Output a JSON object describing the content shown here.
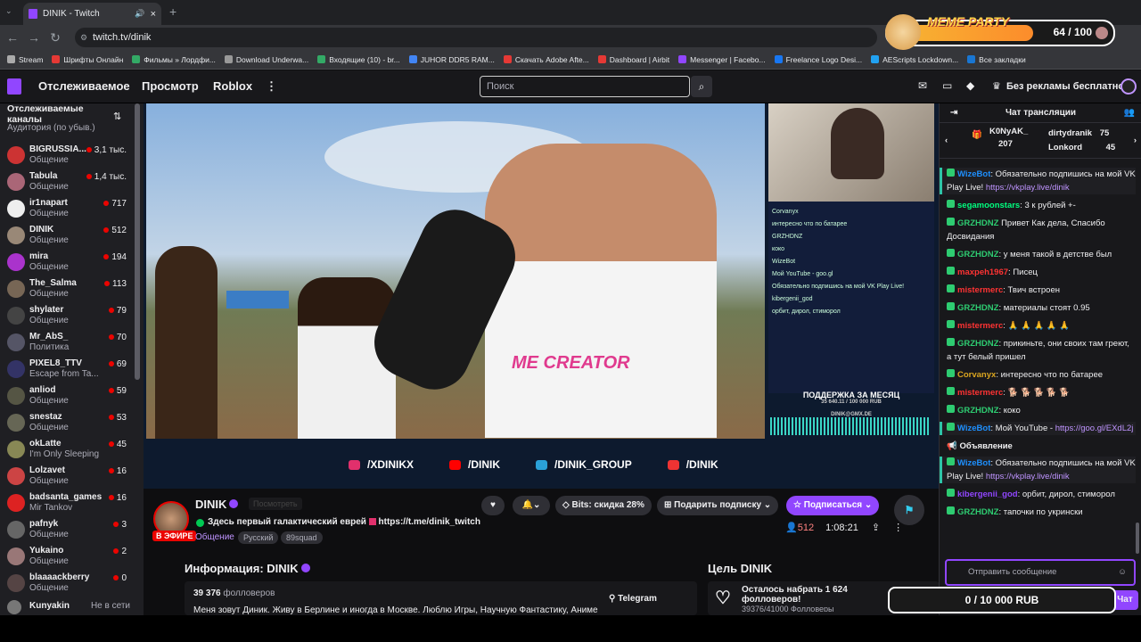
{
  "browser": {
    "tab_title": "DINIK - Twitch",
    "url": "twitch.tv/dinik",
    "bookmarks": [
      "Stream",
      "Шрифты Онлайн",
      "Фильмы » Лордфи...",
      "Download Underwa...",
      "Входящие (10) - br...",
      "JUHOR DDR5 RAM...",
      "Скачать Adobe Afte...",
      "Dashboard | Airbit",
      "Messenger | Facebo...",
      "Freelance Logo Desi...",
      "AEScripts Lockdown...",
      "Все закладки"
    ],
    "bookmark_colors": [
      "#aaaaaa",
      "#e53935",
      "#3a6",
      "#999999",
      "#3a6",
      "#4285f4",
      "#e53935",
      "#e53935",
      "#9146ff",
      "#1877f2",
      "#21a1f1",
      "#1976d2"
    ]
  },
  "meme_party": {
    "title": "MEME PARTY",
    "count": "64 / 100",
    "progress": 0.64
  },
  "twitch_nav": {
    "following": "Отслеживаемое",
    "browse": "Просмотр",
    "roblox": "Roblox",
    "search_placeholder": "Поиск",
    "no_ads": "Без рекламы бесплатно"
  },
  "sidebar": {
    "header": "Отслеживаемые каналы",
    "sort": "Аудитория (по убыв.)",
    "channels": [
      {
        "name": "BIGRUSSIA...",
        "category": "Общение",
        "viewers": "3,1 тыс.",
        "color": "#c33"
      },
      {
        "name": "Tabula",
        "category": "Общение",
        "viewers": "1,4 тыс.",
        "color": "#a67"
      },
      {
        "name": "ir1napart",
        "category": "Общение",
        "viewers": "717",
        "color": "#eee"
      },
      {
        "name": "DINIK",
        "category": "Общение",
        "viewers": "512",
        "color": "#987"
      },
      {
        "name": "mira",
        "category": "Общение",
        "viewers": "194",
        "color": "#a3c"
      },
      {
        "name": "The_Salma",
        "category": "Общение",
        "viewers": "113",
        "color": "#765"
      },
      {
        "name": "shylater",
        "category": "Общение",
        "viewers": "79",
        "color": "#444"
      },
      {
        "name": "Mr_AbS_",
        "category": "Политика",
        "viewers": "70",
        "color": "#556"
      },
      {
        "name": "PIXEL8_TTV",
        "category": "Escape from Ta...",
        "viewers": "69",
        "color": "#336"
      },
      {
        "name": "anliod",
        "category": "Общение",
        "viewers": "59",
        "color": "#554"
      },
      {
        "name": "snestaz",
        "category": "Общение",
        "viewers": "53",
        "color": "#665"
      },
      {
        "name": "okLatte",
        "category": "I'm Only Sleeping",
        "viewers": "45",
        "color": "#885"
      },
      {
        "name": "Lolzavet",
        "category": "Общение",
        "viewers": "16",
        "color": "#c44"
      },
      {
        "name": "badsanta_games",
        "category": "Mir Tankov",
        "viewers": "16",
        "color": "#d22"
      },
      {
        "name": "pafnyk",
        "category": "Общение",
        "viewers": "3",
        "color": "#666"
      },
      {
        "name": "Yukaino",
        "category": "Общение",
        "viewers": "2",
        "color": "#977"
      },
      {
        "name": "blaaaackberry",
        "category": "Общение",
        "viewers": "0",
        "color": "#544"
      }
    ],
    "offline": {
      "name": "Kunyakin",
      "status": "Не в сети"
    }
  },
  "video": {
    "shirt_text": "ME CREATOR",
    "overlay_chat": [
      "Corvanyx",
      "интересно что по батарее",
      "GRZHDNZ",
      "коко",
      "WizeBot",
      "Мой YouTube - goo.gl",
      "Обязательно подпишись на мой VK Play Live!",
      "kibergenii_god",
      "орбит, дирол, стиморол"
    ],
    "support_title": "ПОДДЕРЖКА ЗА МЕСЯЦ",
    "support_value": "35 640.11 / 100 000 RUB",
    "support_email": "DINIK@GMX.DE",
    "socials": [
      {
        "text": "/XDINIKX",
        "color": "#e1306c"
      },
      {
        "text": "/DINIK",
        "color": "#ff0000"
      },
      {
        "text": "/DINIK_GROUP",
        "color": "#2aa1d8"
      },
      {
        "text": "/DINIK",
        "color": "#e33"
      }
    ]
  },
  "stream": {
    "name": "DINIK",
    "live": "В ЭФИРЕ",
    "follow_label": "Посмотреть",
    "title": "Здесь первый галактический еврей",
    "link": "https://t.me/dinik_twitch",
    "category": "Общение",
    "tags": [
      "Русский",
      "89squad"
    ],
    "bits": "Bits: скидка 28%",
    "gift": "Подарить подписку",
    "subscribe": "Подписаться",
    "viewers": "512",
    "uptime": "1:08:21",
    "info_title": "Информация: DINIK",
    "followers": "39 376",
    "followers_label": "фолловеров",
    "about": "Меня зовут Диник. Живу в Берлине и иногда в Москве. Люблю Игры, Научную Фантастику, Аниме",
    "telegram": "Telegram",
    "goal_title": "Цель DINIK",
    "goal_text": "Осталось набрать 1 624 фолловеров!",
    "goal_progress": "39376/41000 Фолловеры"
  },
  "chat": {
    "title": "Чат трансляции",
    "gifters": [
      {
        "name": "K0NyAK_",
        "count": "207"
      },
      {
        "name": "dirtydranik",
        "count": "75"
      },
      {
        "name": "Lonkord",
        "count": "45"
      }
    ],
    "messages": [
      {
        "user": "WizeBot",
        "color": "#1e90ff",
        "text": ": Обязательно подпишись на мой VK Play Live! ",
        "link": "https://vkplay.live/dinik",
        "hl": true
      },
      {
        "user": "segamoonstars",
        "color": "#00ff7f",
        "text": ": 3 к рублей +-"
      },
      {
        "user": "GRZHDNZ",
        "color": "#2ecc71",
        "text": " Привет Как дела, Спасибо Досвидания"
      },
      {
        "user": "GRZHDNZ",
        "color": "#2ecc71",
        "text": ": у меня такой в детстве был"
      },
      {
        "user": "maxpeh1967",
        "color": "#ff3333",
        "text": ": Писец"
      },
      {
        "user": "mistermerc",
        "color": "#ff3333",
        "text": ": Твич встроен"
      },
      {
        "user": "GRZHDNZ",
        "color": "#2ecc71",
        "text": ": материалы стоят 0.95"
      },
      {
        "user": "mistermerc",
        "color": "#ff3333",
        "text": ": 🙏 🙏 🙏 🙏 🙏"
      },
      {
        "user": "GRZHDNZ",
        "color": "#2ecc71",
        "text": ": прикиньте, они своих там греют, а тут белый пришел"
      },
      {
        "user": "Corvanyx",
        "color": "#daa520",
        "text": ": интересно что по батарее"
      },
      {
        "user": "mistermerc",
        "color": "#ff3333",
        "text": ": 🐕 🐕 🐕 🐕 🐕"
      },
      {
        "user": "GRZHDNZ",
        "color": "#2ecc71",
        "text": ": коко"
      },
      {
        "user": "WizeBot",
        "color": "#1e90ff",
        "text": ": Мой YouTube - ",
        "link": "https://goo.gl/EXdL2j",
        "hl": true
      }
    ],
    "announcement_label": "Объявление",
    "announcement": {
      "user": "WizeBot",
      "color": "#1e90ff",
      "text": ": Обязательно подпишись на мой VK Play Live! ",
      "link": "https://vkplay.live/dinik"
    },
    "after": [
      {
        "user": "kibergenii_god",
        "color": "#9146ff",
        "text": ": орбит, дирол, стиморол"
      },
      {
        "user": "GRZHDNZ",
        "color": "#2ecc71",
        "text": ": тапочки по укрински"
      }
    ],
    "input_placeholder": "Отправить сообщение",
    "send": "Чат",
    "rub_goal": "0 / 10 000 RUB"
  }
}
